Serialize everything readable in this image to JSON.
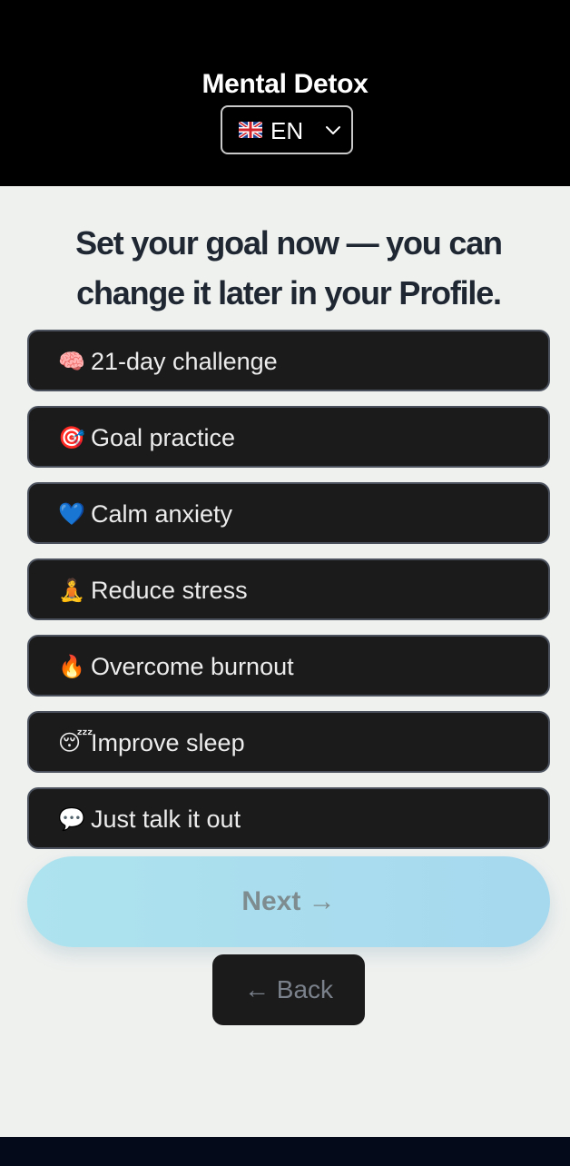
{
  "header": {
    "title": "Mental Detox",
    "language": {
      "code": "EN",
      "flag_icon": "uk-flag-icon"
    }
  },
  "heading": "Set your goal now — you can change it later in your Profile.",
  "options": [
    {
      "icon": "🧠",
      "icon_name": "brain-icon",
      "label": "21-day challenge"
    },
    {
      "icon": "🎯",
      "icon_name": "target-icon",
      "label": "Goal practice"
    },
    {
      "icon": "💙",
      "icon_name": "blue-heart-icon",
      "label": "Calm anxiety"
    },
    {
      "icon": "🧘",
      "icon_name": "meditation-icon",
      "label": "Reduce stress"
    },
    {
      "icon": "🔥",
      "icon_name": "fire-icon",
      "label": "Overcome burnout"
    },
    {
      "icon": "😴",
      "icon_name": "sleeping-face-icon",
      "label": "Improve sleep"
    },
    {
      "icon": "💬",
      "icon_name": "speech-bubble-icon",
      "label": "Just talk it out"
    }
  ],
  "next_label": "Next →",
  "back_label": "← Back",
  "colors": {
    "header_bg": "#000000",
    "page_bg": "#eff1ef",
    "option_bg": "#1b1b1b",
    "option_border": "#4b525e",
    "next_gradient_start": "#ade3ee",
    "next_gradient_end": "#a6d8ee"
  }
}
